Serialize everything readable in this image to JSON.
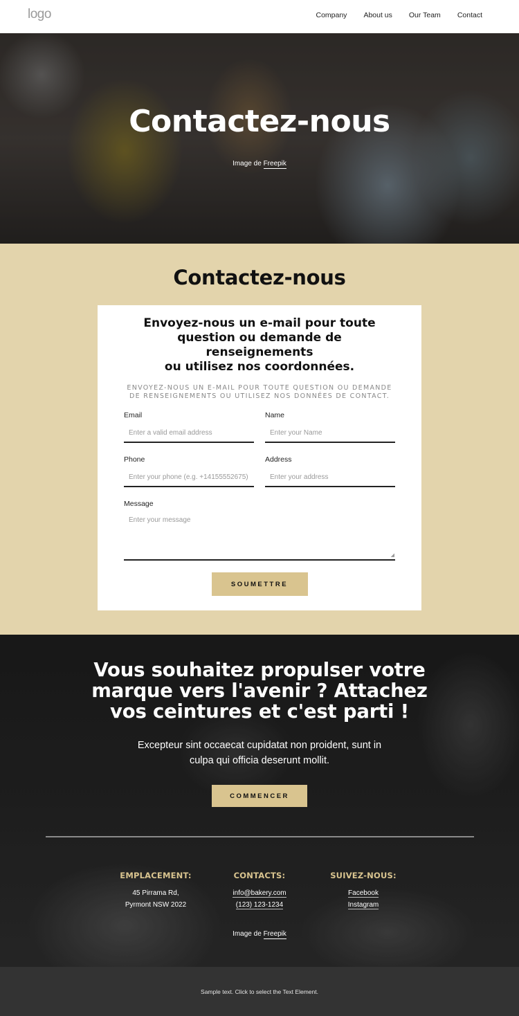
{
  "header": {
    "logo": "logo",
    "nav": [
      "Company",
      "About us",
      "Our Team",
      "Contact"
    ]
  },
  "hero": {
    "title": "Contactez-nous",
    "credit_prefix": "Image de ",
    "credit_link": "Freepik"
  },
  "contact": {
    "title": "Contactez-nous",
    "card_heading_lines": [
      "Envoyez-nous un e-mail pour toute",
      "question ou demande de",
      "renseignements",
      "ou utilisez nos coordonnées."
    ],
    "card_subtitle": "Envoyez-nous un e-mail pour toute question ou demande de renseignements ou utilisez nos données de contact.",
    "fields": {
      "email": {
        "label": "Email",
        "placeholder": "Enter a valid email address"
      },
      "name": {
        "label": "Name",
        "placeholder": "Enter your Name"
      },
      "phone": {
        "label": "Phone",
        "placeholder": "Enter your phone (e.g. +14155552675)"
      },
      "address": {
        "label": "Address",
        "placeholder": "Enter your address"
      },
      "message": {
        "label": "Message",
        "placeholder": "Enter your message"
      }
    },
    "submit_label": "SOUMETTRE",
    "accent_color": "#d9c48f",
    "background_color": "#e3d4ac"
  },
  "cta": {
    "heading_lines": [
      "Vous souhaitez propulser votre",
      "marque vers l'avenir ? Attachez",
      "vos ceintures et c'est parti !"
    ],
    "text_lines": [
      "Excepteur sint occaecat cupidatat non proident, sunt in",
      "culpa qui officia deserunt mollit."
    ],
    "button_label": "COMMENCER",
    "columns": [
      {
        "title": "EMPLACEMENT:",
        "lines": [
          "45 Pirrama Rd,",
          "Pyrmont NSW 2022"
        ]
      },
      {
        "title": "CONTACTS:",
        "links": [
          "info@bakery.com",
          "(123) 123-1234"
        ]
      },
      {
        "title": "SUIVEZ-NOUS:",
        "links": [
          "Facebook",
          "Instagram"
        ]
      }
    ],
    "credit_prefix": "Image de ",
    "credit_link": "Freepik"
  },
  "footer": {
    "text": "Sample text. Click to select the Text Element."
  }
}
